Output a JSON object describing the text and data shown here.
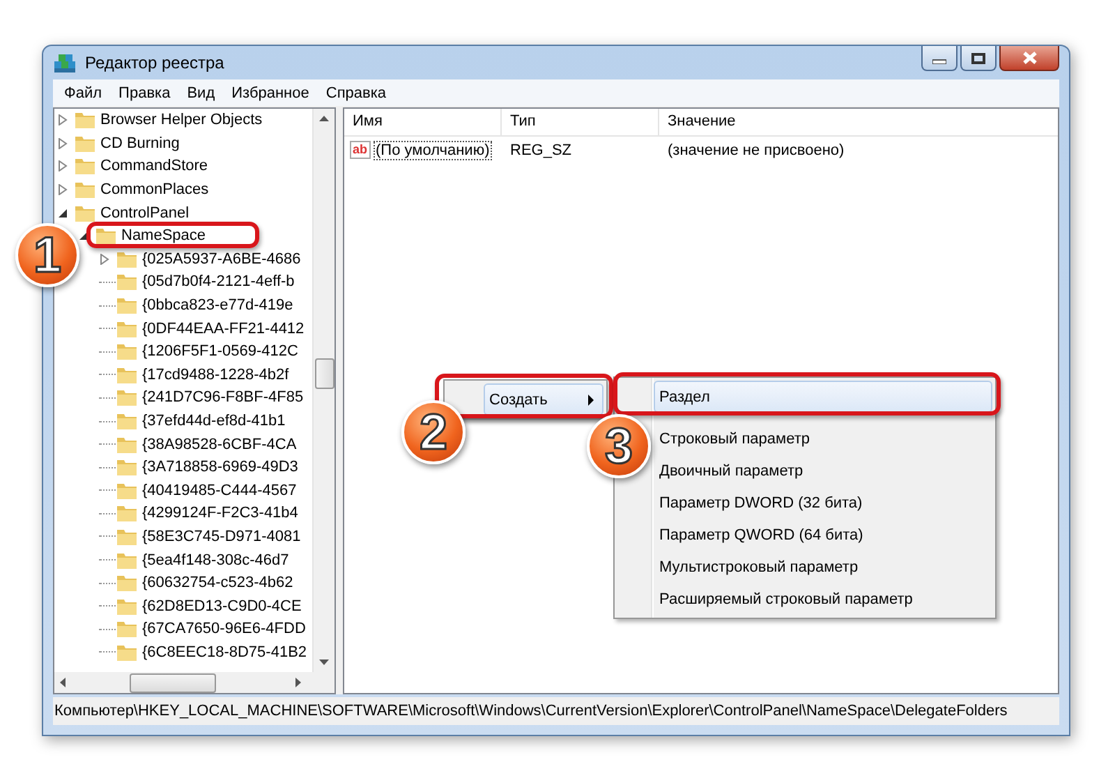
{
  "window": {
    "title": "Редактор реестра"
  },
  "menu": [
    "Файл",
    "Правка",
    "Вид",
    "Избранное",
    "Справка"
  ],
  "tree": [
    {
      "label": "Browser Helper Objects",
      "expandable": true,
      "expanded": false
    },
    {
      "label": "CD Burning",
      "expandable": true,
      "expanded": false
    },
    {
      "label": "CommandStore",
      "expandable": true,
      "expanded": false
    },
    {
      "label": "CommonPlaces",
      "expandable": true,
      "expanded": false
    },
    {
      "label": "ControlPanel",
      "expandable": true,
      "expanded": true,
      "children": [
        {
          "label": "NameSpace",
          "expandable": true,
          "expanded": true,
          "children": [
            {
              "label": "{025A5937-A6BE-4686",
              "expandable": true,
              "expanded": false
            },
            {
              "label": "{05d7b0f4-2121-4eff-b",
              "expandable": false
            },
            {
              "label": "{0bbca823-e77d-419e",
              "expandable": false
            },
            {
              "label": "{0DF44EAA-FF21-4412",
              "expandable": false
            },
            {
              "label": "{1206F5F1-0569-412C",
              "expandable": false
            },
            {
              "label": "{17cd9488-1228-4b2f",
              "expandable": false
            },
            {
              "label": "{241D7C96-F8BF-4F85",
              "expandable": false
            },
            {
              "label": "{37efd44d-ef8d-41b1",
              "expandable": false
            },
            {
              "label": "{38A98528-6CBF-4CA",
              "expandable": false
            },
            {
              "label": "{3A718858-6969-49D3",
              "expandable": false
            },
            {
              "label": "{40419485-C444-4567",
              "expandable": false
            },
            {
              "label": "{4299124F-F2C3-41b4",
              "expandable": false
            },
            {
              "label": "{58E3C745-D971-4081",
              "expandable": false
            },
            {
              "label": "{5ea4f148-308c-46d7",
              "expandable": false
            },
            {
              "label": "{60632754-c523-4b62",
              "expandable": false
            },
            {
              "label": "{62D8ED13-C9D0-4CE",
              "expandable": false
            },
            {
              "label": "{67CA7650-96E6-4FDD",
              "expandable": false
            },
            {
              "label": "{6C8EEC18-8D75-41B2",
              "expandable": false
            }
          ]
        }
      ]
    }
  ],
  "table": {
    "columns": [
      "Имя",
      "Тип",
      "Значение"
    ],
    "rows": [
      {
        "icon": "ab",
        "name": "(По умолчанию)",
        "type": "REG_SZ",
        "value": "(значение не присвоено)",
        "selected": true
      }
    ]
  },
  "context_menu": {
    "items": [
      {
        "label": "Создать",
        "selected": true,
        "submenu": true
      }
    ]
  },
  "submenu": {
    "items": [
      {
        "label": "Раздел",
        "selected": true
      },
      {
        "label": "Строковый параметр",
        "selected": false
      },
      {
        "label": "Двоичный параметр",
        "selected": false
      },
      {
        "label": "Параметр DWORD (32 бита)",
        "selected": false
      },
      {
        "label": "Параметр QWORD (64 бита)",
        "selected": false
      },
      {
        "label": "Мультистроковый параметр",
        "selected": false
      },
      {
        "label": "Расширяемый строковый параметр",
        "selected": false
      }
    ]
  },
  "annotations": [
    {
      "label": "1"
    },
    {
      "label": "2"
    },
    {
      "label": "3"
    }
  ],
  "status_bar": "Компьютер\\HKEY_LOCAL_MACHINE\\SOFTWARE\\Microsoft\\Windows\\CurrentVersion\\Explorer\\ControlPanel\\NameSpace\\DelegateFolders"
}
